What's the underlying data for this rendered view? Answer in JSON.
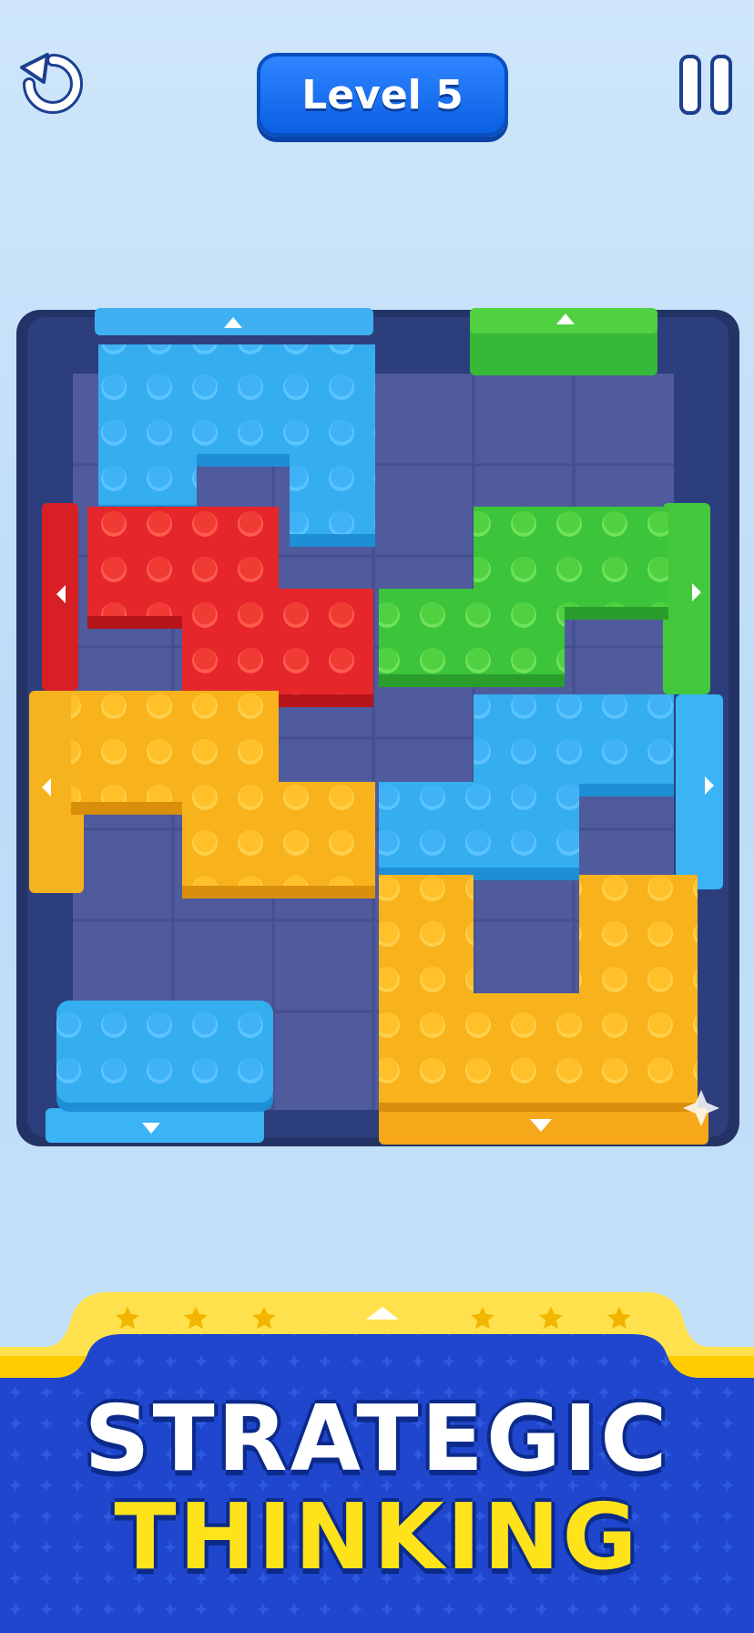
{
  "header": {
    "level_label": "Level 5",
    "restart_icon": "restart-icon",
    "pause_icon": "pause-icon"
  },
  "board": {
    "grid_cols": 6,
    "grid_rows": 8,
    "colors": {
      "frame": "#2d3e7c",
      "cell": "#4f5b9d",
      "blue": "#2ea7ee",
      "red": "#e5262b",
      "green": "#3cc43a",
      "yellow": "#f8b21c"
    },
    "blocks": [
      {
        "name": "blue-block-top",
        "color": "blue"
      },
      {
        "name": "red-block",
        "color": "red"
      },
      {
        "name": "green-block",
        "color": "green"
      },
      {
        "name": "yellow-block-left",
        "color": "yellow"
      },
      {
        "name": "blue-block-middle",
        "color": "blue"
      },
      {
        "name": "yellow-block-bottom",
        "color": "yellow"
      },
      {
        "name": "blue-block-bottom",
        "color": "blue"
      }
    ],
    "exit_gates": [
      {
        "name": "blue-gate-top",
        "color": "blue",
        "arrow": "up"
      },
      {
        "name": "green-gate-top",
        "color": "green",
        "arrow": "up"
      },
      {
        "name": "red-gate-left",
        "color": "red",
        "arrow": "left"
      },
      {
        "name": "yellow-gate-left",
        "color": "yellow",
        "arrow": "left"
      },
      {
        "name": "green-gate-right",
        "color": "green",
        "arrow": "right"
      },
      {
        "name": "blue-gate-right",
        "color": "blue",
        "arrow": "right"
      },
      {
        "name": "blue-gate-bottom",
        "color": "blue",
        "arrow": "down"
      },
      {
        "name": "yellow-gate-bottom",
        "color": "yellow",
        "arrow": "down"
      }
    ]
  },
  "banner": {
    "line1": "STRATEGIC",
    "line2": "THINKING",
    "colors": {
      "bg": "#1f46cc",
      "trim": "#ffcc00",
      "line1": "#ffffff",
      "line2": "#ffe31a"
    }
  }
}
